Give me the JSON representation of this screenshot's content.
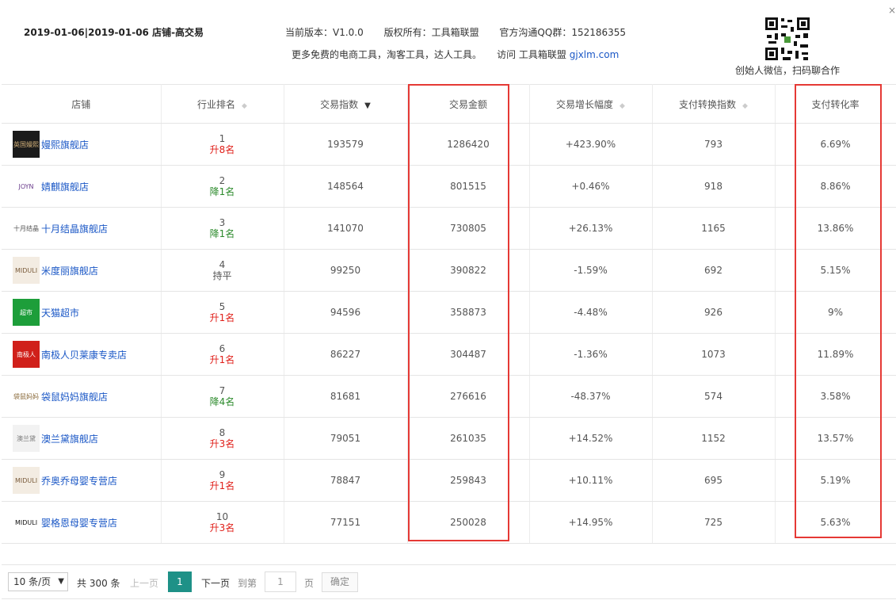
{
  "header": {
    "date_shop": "2019-01-06|2019-01-06 店铺-高交易",
    "version": "当前版本：V1.0.0",
    "copyright": "版权所有：工具箱联盟",
    "qq_group": "官方沟通QQ群：152186355",
    "promo": "更多免费的电商工具，淘客工具，达人工具。",
    "visit_label": "访问 工具箱联盟",
    "visit_link": "gjxlm.com",
    "qr_caption": "创始人微信，扫码聊合作",
    "close_label": "×"
  },
  "table": {
    "columns": [
      "店铺",
      "行业排名",
      "交易指数",
      "交易金额",
      "交易增长幅度",
      "支付转换指数",
      "支付转化率"
    ],
    "rows": [
      {
        "logo": "英国嫚熙",
        "logo_bg": "#1b1b1b",
        "logo_fg": "#d4b27a",
        "shop": "嫚熙旗舰店",
        "rank": "1",
        "rank_change": "升8名",
        "dir": "up",
        "trade_index": "193579",
        "amount": "1286420",
        "growth": "+423.90%",
        "growth_dir": "up",
        "pay_index": "793",
        "pay_rate": "6.69%"
      },
      {
        "logo": "JOYN",
        "logo_bg": "#ffffff",
        "logo_fg": "#6a3c8c",
        "shop": "婧麒旗舰店",
        "rank": "2",
        "rank_change": "降1名",
        "dir": "down",
        "trade_index": "148564",
        "amount": "801515",
        "growth": "+0.46%",
        "growth_dir": "up",
        "pay_index": "918",
        "pay_rate": "8.86%"
      },
      {
        "logo": "十月结晶",
        "logo_bg": "#ffffff",
        "logo_fg": "#555555",
        "shop": "十月结晶旗舰店",
        "rank": "3",
        "rank_change": "降1名",
        "dir": "down",
        "trade_index": "141070",
        "amount": "730805",
        "growth": "+26.13%",
        "growth_dir": "up",
        "pay_index": "1165",
        "pay_rate": "13.86%"
      },
      {
        "logo": "MIDULI",
        "logo_bg": "#f3ece2",
        "logo_fg": "#7a5c3c",
        "shop": "米度丽旗舰店",
        "rank": "4",
        "rank_change": "持平",
        "dir": "flat",
        "trade_index": "99250",
        "amount": "390822",
        "growth": "-1.59%",
        "growth_dir": "down",
        "pay_index": "692",
        "pay_rate": "5.15%"
      },
      {
        "logo": "超市",
        "logo_bg": "#1d9e3a",
        "logo_fg": "#ffffff",
        "shop": "天猫超市",
        "rank": "5",
        "rank_change": "升1名",
        "dir": "up",
        "trade_index": "94596",
        "amount": "358873",
        "growth": "-4.48%",
        "growth_dir": "down",
        "pay_index": "926",
        "pay_rate": "9%"
      },
      {
        "logo": "南极人",
        "logo_bg": "#d0201a",
        "logo_fg": "#ffffff",
        "shop": "南极人贝莱康专卖店",
        "rank": "6",
        "rank_change": "升1名",
        "dir": "up",
        "trade_index": "86227",
        "amount": "304487",
        "growth": "-1.36%",
        "growth_dir": "down",
        "pay_index": "1073",
        "pay_rate": "11.89%"
      },
      {
        "logo": "袋鼠妈妈",
        "logo_bg": "#ffffff",
        "logo_fg": "#8a6a3a",
        "shop": "袋鼠妈妈旗舰店",
        "rank": "7",
        "rank_change": "降4名",
        "dir": "down",
        "trade_index": "81681",
        "amount": "276616",
        "growth": "-48.37%",
        "growth_dir": "down",
        "pay_index": "574",
        "pay_rate": "3.58%"
      },
      {
        "logo": "澳兰黛",
        "logo_bg": "#f2f2f2",
        "logo_fg": "#777777",
        "shop": "澳兰黛旗舰店",
        "rank": "8",
        "rank_change": "升3名",
        "dir": "up",
        "trade_index": "79051",
        "amount": "261035",
        "growth": "+14.52%",
        "growth_dir": "up",
        "pay_index": "1152",
        "pay_rate": "13.57%"
      },
      {
        "logo": "MIDULI",
        "logo_bg": "#f3ece2",
        "logo_fg": "#7a5c3c",
        "shop": "乔奥乔母婴专营店",
        "rank": "9",
        "rank_change": "升1名",
        "dir": "up",
        "trade_index": "78847",
        "amount": "259843",
        "growth": "+10.11%",
        "growth_dir": "up",
        "pay_index": "695",
        "pay_rate": "5.19%"
      },
      {
        "logo": "MIDULI",
        "logo_bg": "#ffffff",
        "logo_fg": "#111111",
        "shop": "婴格恩母婴专营店",
        "rank": "10",
        "rank_change": "升3名",
        "dir": "up",
        "trade_index": "77151",
        "amount": "250028",
        "growth": "+14.95%",
        "growth_dir": "up",
        "pay_index": "725",
        "pay_rate": "5.63%"
      }
    ]
  },
  "pagination": {
    "page_size": "10 条/页",
    "total": "共 300 条",
    "prev": "上一页",
    "current": "1",
    "next": "下一页",
    "goto": "到第",
    "goto_value": "1",
    "page_unit": "页",
    "confirm": "确定"
  },
  "colors": {
    "up": "#e0201a",
    "down": "#2b8a2b",
    "link": "#1a57c6",
    "highlight_box": "#e53935",
    "current_page": "#1e9187"
  }
}
